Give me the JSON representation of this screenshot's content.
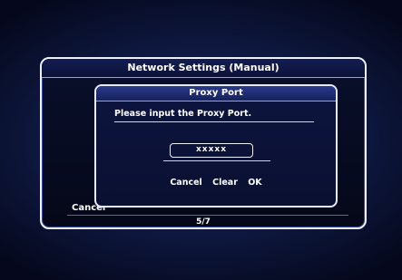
{
  "outer": {
    "title": "Network Settings (Manual)",
    "cancel_label": "Cancel",
    "page_indicator": "5/7"
  },
  "dialog": {
    "title": "Proxy Port",
    "prompt": "Please input the Proxy Port.",
    "input_value": "xxxxx",
    "buttons": {
      "cancel": "Cancel",
      "clear": "Clear",
      "ok": "OK"
    }
  }
}
